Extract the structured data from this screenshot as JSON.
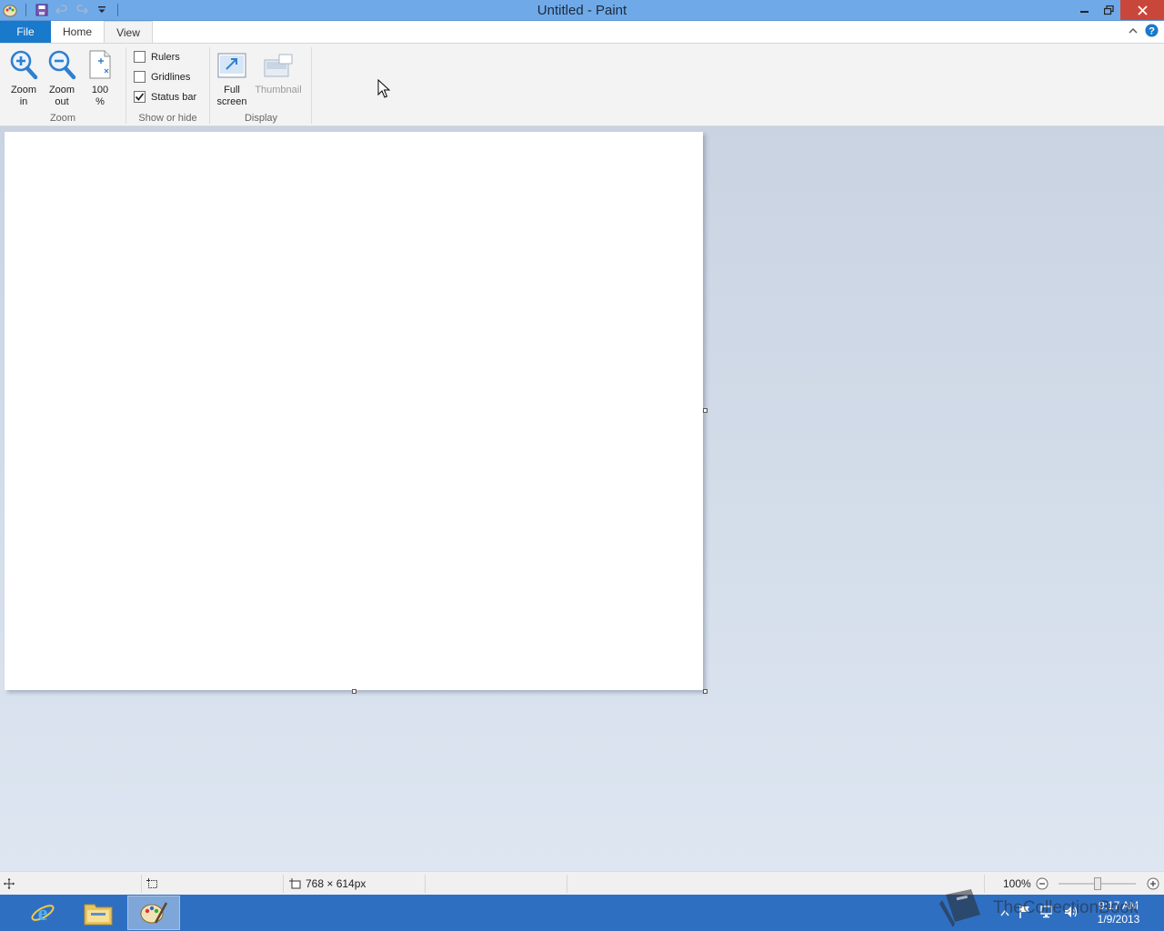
{
  "window": {
    "title": "Untitled - Paint"
  },
  "tabs": {
    "file": "File",
    "home": "Home",
    "view": "View"
  },
  "ribbon": {
    "zoom_group": {
      "label": "Zoom",
      "zoom_in": [
        "Zoom",
        "in"
      ],
      "zoom_out": [
        "Zoom",
        "out"
      ],
      "hundred": [
        "100",
        "%"
      ]
    },
    "show_hide_group": {
      "label": "Show or hide",
      "rulers": {
        "label": "Rulers",
        "checked": false
      },
      "gridlines": {
        "label": "Gridlines",
        "checked": false
      },
      "status_bar": {
        "label": "Status bar",
        "checked": true
      }
    },
    "display_group": {
      "label": "Display",
      "full_screen": [
        "Full",
        "screen"
      ],
      "thumbnail": "Thumbnail"
    }
  },
  "statusbar": {
    "canvas_size": "768 × 614px",
    "zoom_level": "100%"
  },
  "taskbar": {
    "time": "9:17 AM",
    "date": "1/9/2013"
  },
  "watermark": {
    "text": "TheCollectionBook"
  },
  "colors": {
    "titlebar": "#6fa9e8",
    "file_tab": "#1979ca",
    "taskbar": "#2f6fc2",
    "close_button": "#c9473a"
  }
}
